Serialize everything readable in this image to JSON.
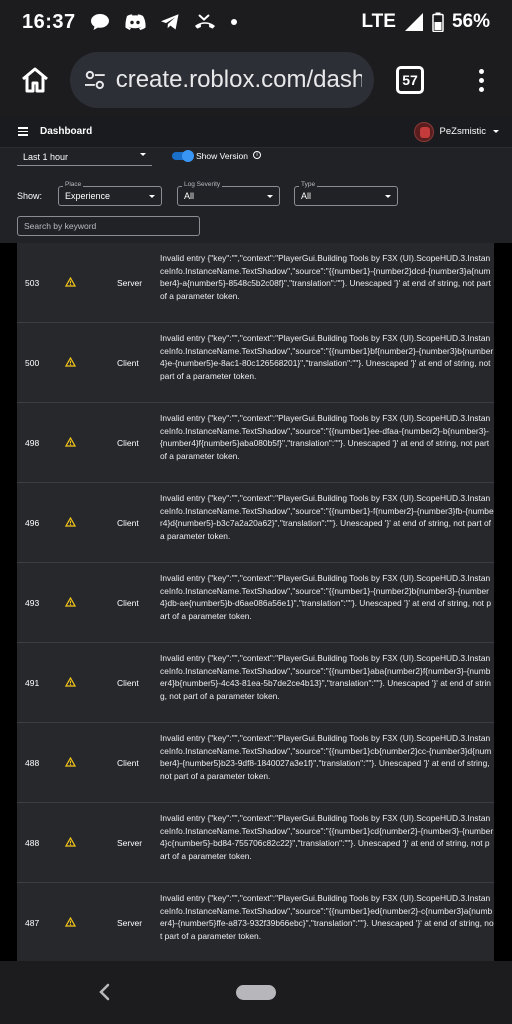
{
  "status_bar": {
    "time": "16:37",
    "network": "LTE",
    "battery": "56%"
  },
  "browser": {
    "url": "create.roblox.com/dash",
    "tab_count": "57"
  },
  "app": {
    "title": "Dashboard",
    "username": "PeZsmistic"
  },
  "filters": {
    "time_range": "Last 1 hour",
    "show_version_label": "Show Version",
    "show_label": "Show:",
    "place": {
      "label": "Place",
      "value": "Experience"
    },
    "log_severity": {
      "label": "Log Severity",
      "value": "All"
    },
    "type": {
      "label": "Type",
      "value": "All"
    },
    "search_placeholder": "Search by keyword"
  },
  "logs": [
    {
      "count": "503",
      "source": "Server",
      "message": "Invalid entry {\"key\":\"\",\"context\":\"PlayerGui.Building Tools by F3X (UI).ScopeHUD.3.InstanceInfo.InstanceName.TextShadow\",\"source\":\"{{number1}-{number2}dcd-{number3}a{number4}-a{number5}-8548c5b2c08f}\",\"translation\":\"\"}. Unescaped '}' at end of string, not part of a parameter token."
    },
    {
      "count": "500",
      "source": "Client",
      "message": "Invalid entry {\"key\":\"\",\"context\":\"PlayerGui.Building Tools by F3X (UI).ScopeHUD.3.InstanceInfo.InstanceName.TextShadow\",\"source\":\"{{number1}bf{number2}-{number3}b{number4}e-{number5}e-8ac1-80c126568201}\",\"translation\":\"\"}. Unescaped '}' at end of string, not part of a parameter token."
    },
    {
      "count": "498",
      "source": "Client",
      "message": "Invalid entry {\"key\":\"\",\"context\":\"PlayerGui.Building Tools by F3X (UI).ScopeHUD.3.InstanceInfo.InstanceName.TextShadow\",\"source\":\"{{number1}ee-dfaa-{number2}-b{number3}-{number4}f{number5}aba080b5f}\",\"translation\":\"\"}. Unescaped '}' at end of string, not part of a parameter token."
    },
    {
      "count": "496",
      "source": "Client",
      "message": "Invalid entry {\"key\":\"\",\"context\":\"PlayerGui.Building Tools by F3X (UI).ScopeHUD.3.InstanceInfo.InstanceName.TextShadow\",\"source\":\"{{number1}-f{number2}-{number3}fb-{number4}d{number5}-b3c7a2a20a62}\",\"translation\":\"\"}. Unescaped '}' at end of string, not part of a parameter token."
    },
    {
      "count": "493",
      "source": "Client",
      "message": "Invalid entry {\"key\":\"\",\"context\":\"PlayerGui.Building Tools by F3X (UI).ScopeHUD.3.InstanceInfo.InstanceName.TextShadow\",\"source\":\"{{number1}-{number2}b{number3}-{number4}db-ae{number5}b-d6ae086a56e1}\",\"translation\":\"\"}. Unescaped '}' at end of string, not part of a parameter token."
    },
    {
      "count": "491",
      "source": "Client",
      "message": "Invalid entry {\"key\":\"\",\"context\":\"PlayerGui.Building Tools by F3X (UI).ScopeHUD.3.InstanceInfo.InstanceName.TextShadow\",\"source\":\"{{number1}aba{number2}f{number3}-{number4}b{number5}-4c43-81ea-5b7de2ce4b13}\",\"translation\":\"\"}. Unescaped '}' at end of string, not part of a parameter token."
    },
    {
      "count": "488",
      "source": "Client",
      "message": "Invalid entry {\"key\":\"\",\"context\":\"PlayerGui.Building Tools by F3X (UI).ScopeHUD.3.InstanceInfo.InstanceName.TextShadow\",\"source\":\"{{number1}cb{number2}cc-{number3}d{number4}-{number5}b23-9df8-1840027a3e1f}\",\"translation\":\"\"}. Unescaped '}' at end of string, not part of a parameter token."
    },
    {
      "count": "488",
      "source": "Server",
      "message": "Invalid entry {\"key\":\"\",\"context\":\"PlayerGui.Building Tools by F3X (UI).ScopeHUD.3.InstanceInfo.InstanceName.TextShadow\",\"source\":\"{{number1}cd{number2}-{number3}-{number4}c{number5}-bd84-755706c82c22}\",\"translation\":\"\"}. Unescaped '}' at end of string, not part of a parameter token."
    },
    {
      "count": "487",
      "source": "Server",
      "message": "Invalid entry {\"key\":\"\",\"context\":\"PlayerGui.Building Tools by F3X (UI).ScopeHUD.3.InstanceInfo.InstanceName.TextShadow\",\"source\":\"{{number1}ed{number2}-c{number3}a{number4}-{number5}ffe-a873-932f39b66ebc}\",\"translation\":\"\"}. Unescaped '}' at end of string, not part of a parameter token."
    }
  ]
}
